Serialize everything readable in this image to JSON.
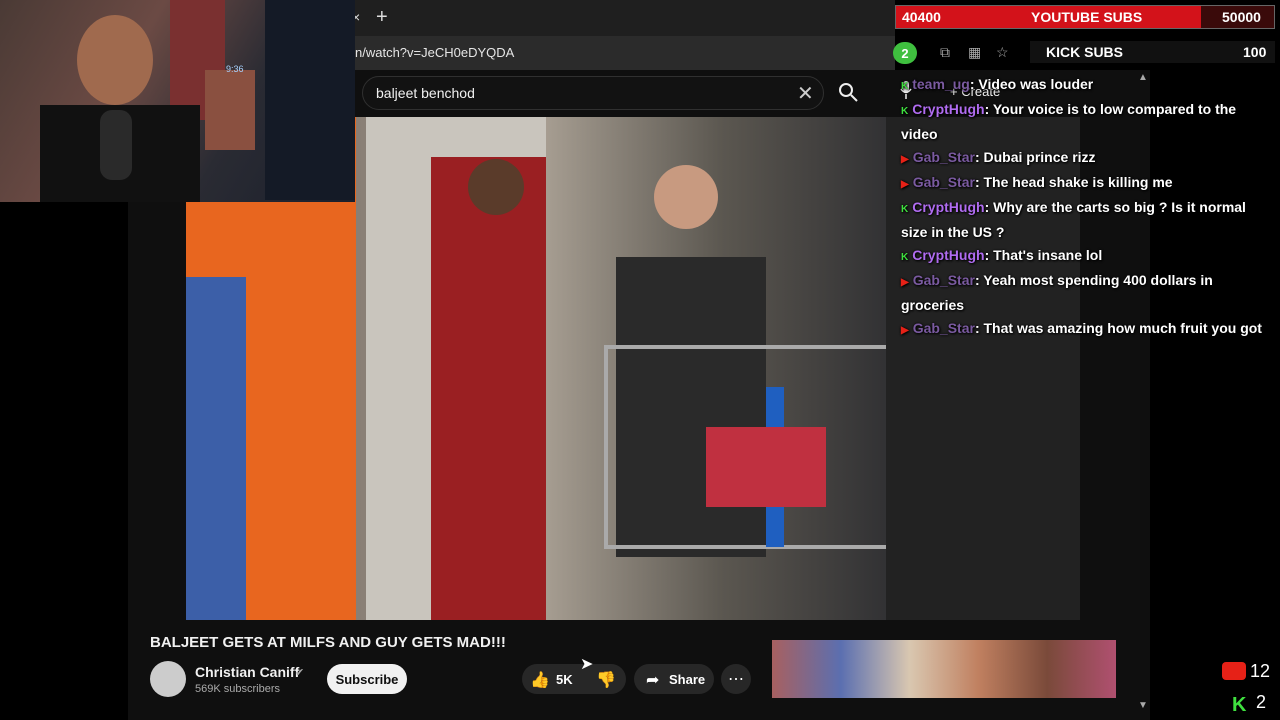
{
  "browser": {
    "tab_close": "×",
    "new_tab": "+",
    "url": "n/watch?v=JeCH0eDYQDA",
    "extension_badge": "2"
  },
  "youtube": {
    "search_query": "baljeet benchod",
    "create_label": "Create",
    "video_title": "BALJEET GETS AT MILFS AND GUY GETS MAD!!!",
    "channel_name": "Christian Caniff",
    "subscribers": "569K subscribers",
    "subscribe_label": "Subscribe",
    "likes": "5K",
    "share_label": "Share"
  },
  "overlay": {
    "yt_goal_current": "40400",
    "yt_goal_label": "YOUTUBE SUBS",
    "yt_goal_target": "50000",
    "yt_goal_progress": 0.808,
    "kick_goal_label": "KICK SUBS",
    "kick_goal_target": "100",
    "yt_viewers": "12",
    "kick_viewers": "2",
    "cam_clock": "9:36"
  },
  "chat": [
    {
      "platform": "kick",
      "user": "team_ug",
      "text": ": Video was louder"
    },
    {
      "platform": "kick",
      "user": "CryptHugh",
      "text": ": Your voice is to low compared to the video"
    },
    {
      "platform": "youtube",
      "user": "Gab_Star",
      "text": ": Dubai prince rizz"
    },
    {
      "platform": "youtube",
      "user": "Gab_Star",
      "text": ": The head shake is killing me"
    },
    {
      "platform": "kick",
      "user": "CryptHugh",
      "text": ": Why are the carts so big ? Is it normal size in the US ?"
    },
    {
      "platform": "kick",
      "user": "CryptHugh",
      "text": ": That's insane lol"
    },
    {
      "platform": "youtube",
      "user": "Gab_Star",
      "text": ": Yeah most spending 400 dollars in groceries"
    },
    {
      "platform": "youtube",
      "user": "Gab_Star",
      "text": ": That was amazing how much fruit you got"
    }
  ],
  "colors": {
    "youtube_red": "#e62117",
    "kick_green": "#3fe03f",
    "chat_name": "#b06cf0"
  }
}
